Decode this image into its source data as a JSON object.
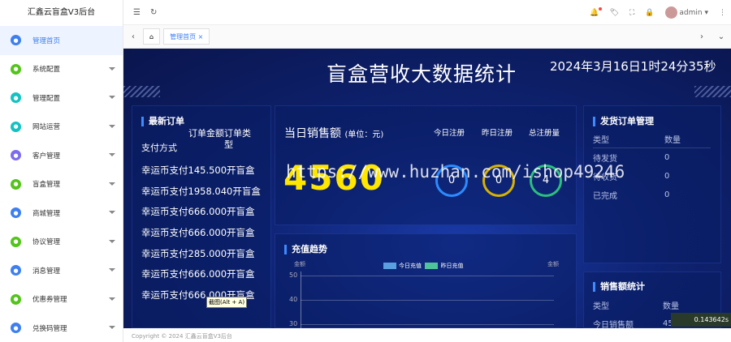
{
  "app": {
    "title": "汇鑫云盲盒V3后台"
  },
  "sidebar": {
    "items": [
      {
        "label": "管理首页",
        "color": "#3d7ff0",
        "active": true
      },
      {
        "label": "系统配置",
        "color": "#52c41a"
      },
      {
        "label": "管理配置",
        "color": "#13c2c2"
      },
      {
        "label": "网站运营",
        "color": "#13c2c2"
      },
      {
        "label": "客户管理",
        "color": "#7b6cf0"
      },
      {
        "label": "盲盒管理",
        "color": "#52c41a"
      },
      {
        "label": "商城管理",
        "color": "#3d7ff0"
      },
      {
        "label": "协议管理",
        "color": "#52c41a"
      },
      {
        "label": "消息管理",
        "color": "#3d7ff0"
      },
      {
        "label": "优惠券管理",
        "color": "#52c41a"
      },
      {
        "label": "兑换码管理",
        "color": "#3d7ff0"
      }
    ]
  },
  "topbar": {
    "user": "admin"
  },
  "tabs": {
    "home_tab": "管理首页"
  },
  "dashboard": {
    "title": "盲盒营收大数据统计",
    "datetime": "2024年3月16日1时24分35秒",
    "latest_orders": {
      "heading": "最新订单",
      "columns": [
        "支付方式",
        "订单金额",
        "订单类型"
      ],
      "rows": [
        "幸运币支付145.500开盲盒",
        "幸运币支付1958.040开盲盒",
        "幸运币支付666.000开盲盒",
        "幸运币支付666.000开盲盒",
        "幸运币支付285.000开盲盒",
        "幸运币支付666.000开盲盒",
        "幸运币支付666.000开盲盒"
      ]
    },
    "sales": {
      "heading": "当日销售额",
      "unit": "(单位：元)",
      "value": "4560",
      "today_reg_label": "今日注册",
      "yest_reg_label": "昨日注册",
      "total_reg_label": "总注册量",
      "today_reg": "0",
      "yest_reg": "0",
      "total_reg": "4"
    },
    "shipping": {
      "heading": "发货订单管理",
      "col_type": "类型",
      "col_count": "数量",
      "rows": [
        {
          "type": "待发货",
          "count": "0"
        },
        {
          "type": "待收货",
          "count": "0"
        },
        {
          "type": "已完成",
          "count": "0"
        }
      ]
    },
    "recharge": {
      "heading": "充值趋势",
      "y_unit_left": "金额",
      "y_unit_right": "金额",
      "legend_today": "今日充值",
      "legend_yest": "昨日充值",
      "ticks": [
        "50",
        "40",
        "30"
      ]
    },
    "sales_stats": {
      "heading": "销售额统计",
      "col_type": "类型",
      "col_count": "数量",
      "first_row": "今日销售额",
      "first_val": "4560"
    }
  },
  "overlay": {
    "watermark": "https://www.huzhan.com/ishop49246",
    "tooltip": "截图(Alt + A)",
    "mini_value": "0.143642s"
  },
  "footer": {
    "copyright": "Copyright © 2024 汇鑫云盲盒V3后台"
  }
}
